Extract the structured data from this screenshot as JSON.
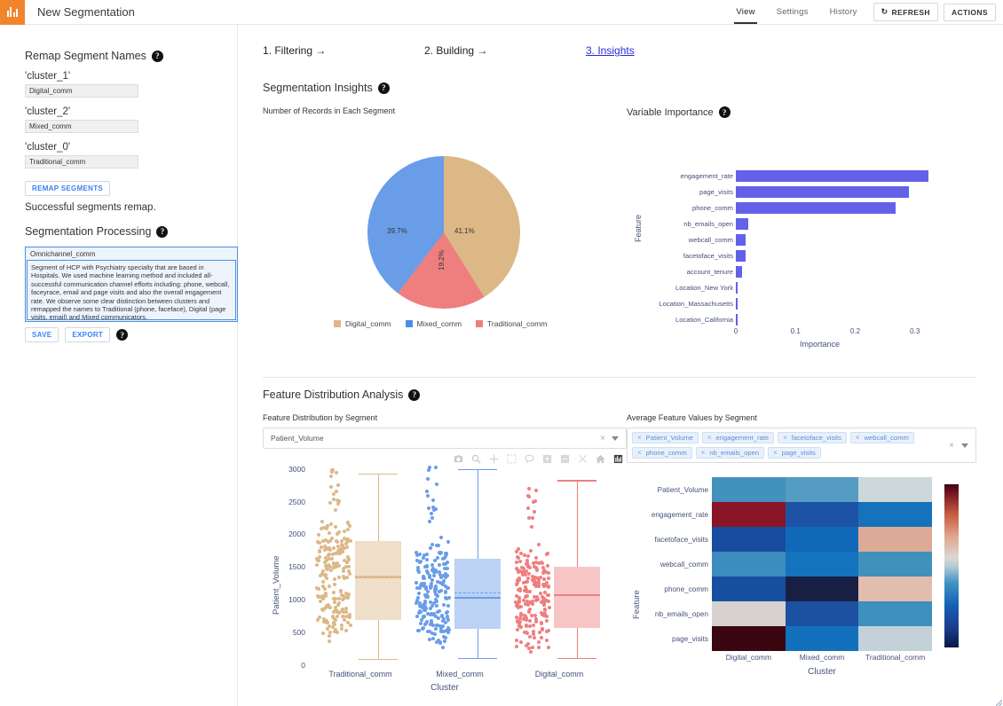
{
  "app": {
    "logo_icon": "bar-chart-logo-icon",
    "title": "New Segmentation"
  },
  "topnav": {
    "tabs": [
      {
        "label": "View",
        "active": true
      },
      {
        "label": "Settings",
        "active": false
      },
      {
        "label": "History",
        "active": false
      }
    ],
    "refresh_label": "REFRESH",
    "refresh_icon": "refresh-icon",
    "actions_label": "ACTIONS"
  },
  "sidebar": {
    "remap_heading": "Remap Segment Names",
    "fields": [
      {
        "label": "'cluster_1'",
        "value": "Digital_comm"
      },
      {
        "label": "'cluster_2'",
        "value": "Mixed_comm"
      },
      {
        "label": "'cluster_0'",
        "value": "Traditional_comm"
      }
    ],
    "remap_button": "REMAP SEGMENTS",
    "remap_message": "Successful segments remap.",
    "processing_heading": "Segmentation Processing",
    "segment_name": "Omnichannel_comm",
    "segment_description": "Segment of HCP with Psychiatry specialty that are based in Hospitals. We used machine learning method and included all-successful communication channel efforts including: phone, webcall, faceyrace, email and page visits and also the overall engagement rate. We observe some clear distinction between clusters and remapped the names to Traditional (phone, faceface), Digital (page visits, email) and Mixed communicators.",
    "save_button": "SAVE",
    "export_button": "EXPORT"
  },
  "steps": [
    {
      "label": "1. Filtering →",
      "active": false
    },
    {
      "label": "2. Building →",
      "active": false
    },
    {
      "label": "3. Insights",
      "active": true
    }
  ],
  "insights": {
    "heading": "Segmentation Insights",
    "pie_title": "Number of Records in Each Segment",
    "importance_title": "Variable Importance"
  },
  "distribution": {
    "heading": "Feature Distribution Analysis",
    "box_title": "Feature Distribution by Segment",
    "selected_feature": "Patient_Volume",
    "heatmap_title": "Average Feature Values by Segment",
    "selected_features": [
      "Patient_Volume",
      "engagement_rate",
      "facetoface_visits",
      "webcall_comm",
      "phone_comm",
      "nb_emails_open",
      "page_visits"
    ],
    "modebar_icons": [
      "camera-icon",
      "zoom-icon",
      "pan-icon",
      "box-select-icon",
      "lasso-icon",
      "zoom-in-icon",
      "zoom-out-icon",
      "autoscale-icon",
      "reset-home-icon",
      "plotly-logo-icon"
    ]
  },
  "colors": {
    "brand_orange": "#f0852c",
    "link_blue": "#2b2bd8",
    "bar_purple": "#6361e8",
    "digital": "#dcb887",
    "mixed": "#6a9de8",
    "traditional": "#ef7f7f"
  },
  "chart_data": [
    {
      "type": "pie",
      "title": "Number of Records in Each Segment",
      "labels": [
        "Digital_comm",
        "Mixed_comm",
        "Traditional_comm"
      ],
      "values": [
        41.1,
        39.7,
        19.2
      ],
      "value_labels": [
        "41.1%",
        "39.7%",
        "19.2%"
      ],
      "colors": [
        "#dcb887",
        "#6a9de8",
        "#ef7f7f"
      ],
      "legend": "bottom"
    },
    {
      "type": "bar",
      "title": "Variable Importance",
      "orientation": "horizontal",
      "xlabel": "Importance",
      "ylabel": "Feature",
      "xlim": [
        0,
        0.345
      ],
      "xticks": [
        0,
        0.1,
        0.2,
        0.3
      ],
      "xtick_labels": [
        "0",
        "0.1",
        "0.2",
        "0.3"
      ],
      "grid": false,
      "categories": [
        "engagement_rate",
        "page_visits",
        "phone_comm",
        "nb_emails_open",
        "webcall_comm",
        "facetoface_visits",
        "account_tenure",
        "Location_New York",
        "Location_Massachusetts",
        "Location_California"
      ],
      "values": [
        0.322,
        0.29,
        0.267,
        0.021,
        0.017,
        0.016,
        0.011,
        0.002,
        0.002,
        0.002
      ],
      "color": "#6361e8"
    },
    {
      "type": "box",
      "title": "Feature Distribution by Segment",
      "xlabel": "Cluster",
      "ylabel": "Patient_Volume",
      "ylim": [
        0,
        3050
      ],
      "yticks": [
        0,
        500,
        1000,
        1500,
        2000,
        2500,
        3000
      ],
      "ytick_labels": [
        "0",
        "500",
        "1000",
        "1500",
        "2000",
        "2500",
        "3000"
      ],
      "categories": [
        "Traditional_comm",
        "Mixed_comm",
        "Digital_comm"
      ],
      "colors": [
        "#dcb887",
        "#6a9de8",
        "#ef7f7f"
      ],
      "boxes": [
        {
          "name": "Traditional_comm",
          "min": 100,
          "q1": 690,
          "median": 1350,
          "mean": 1365,
          "q3": 1900,
          "max": 2930
        },
        {
          "name": "Mixed_comm",
          "min": 110,
          "q1": 550,
          "median": 1040,
          "mean": 1105,
          "q3": 1620,
          "max": 3000
        },
        {
          "name": "Digital_comm",
          "min": 110,
          "q1": 570,
          "median": 1080,
          "mean": 1090,
          "q3": 1500,
          "max": 2830
        }
      ]
    },
    {
      "type": "heatmap",
      "title": "Average Feature Values by Segment",
      "xlabel": "Cluster",
      "ylabel": "Feature",
      "colorscale": "RdBu_r",
      "x": [
        "Digital_comm",
        "Mixed_comm",
        "Traditional_comm"
      ],
      "y": [
        "Patient_Volume",
        "engagement_rate",
        "facetoface_visits",
        "webcall_comm",
        "phone_comm",
        "nb_emails_open",
        "page_visits"
      ],
      "z": [
        [
          -0.3,
          -0.28,
          0.02
        ],
        [
          0.95,
          -0.55,
          -0.45
        ],
        [
          -0.62,
          -0.48,
          0.4
        ],
        [
          -0.32,
          -0.5,
          -0.3
        ],
        [
          -0.6,
          -0.98,
          0.45
        ],
        [
          0.05,
          -0.58,
          -0.3
        ],
        [
          1.0,
          -0.45,
          0.0
        ]
      ],
      "cell_colors": [
        [
          "#4391bd",
          "#549cc1",
          "#ccd8dc"
        ],
        [
          "#8a1527",
          "#1d53a4",
          "#1672bb"
        ],
        [
          "#174c9e",
          "#1068b8",
          "#dcaa96"
        ],
        [
          "#3a8dbe",
          "#1473bd",
          "#4191bd"
        ],
        [
          "#174fa0",
          "#181f44",
          "#e2bcae"
        ],
        [
          "#d7d2cf",
          "#1c51a2",
          "#3d8fbe"
        ],
        [
          "#3a0710",
          "#1270bc",
          "#c2d2d8"
        ]
      ]
    }
  ]
}
